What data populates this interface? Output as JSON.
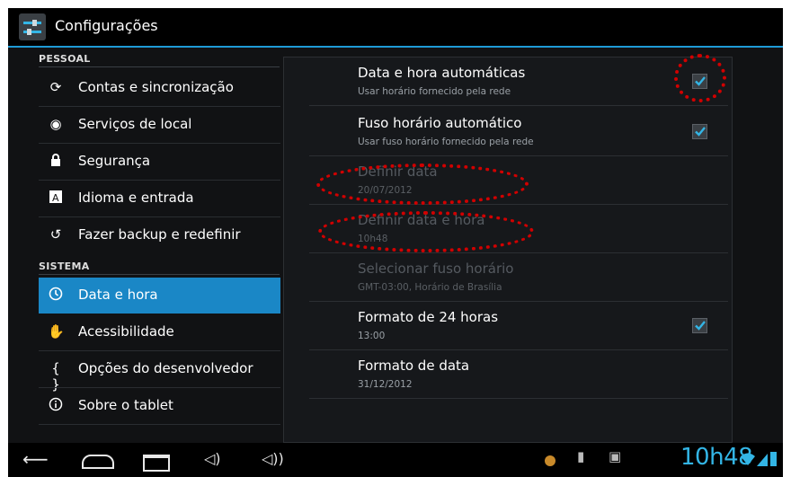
{
  "app": {
    "title": "Configurações"
  },
  "sidebar": {
    "sections": [
      {
        "label": "PESSOAL"
      },
      {
        "label": "SISTEMA"
      }
    ],
    "items": [
      {
        "label": "Contas e sincronização",
        "icon": "sync-icon"
      },
      {
        "label": "Serviços de local",
        "icon": "location-icon"
      },
      {
        "label": "Segurança",
        "icon": "lock-icon"
      },
      {
        "label": "Idioma e entrada",
        "icon": "language-icon"
      },
      {
        "label": "Fazer backup e redefinir",
        "icon": "backup-icon"
      },
      {
        "label": "Data e hora",
        "icon": "clock-icon",
        "active": true
      },
      {
        "label": "Acessibilidade",
        "icon": "hand-icon"
      },
      {
        "label": "Opções do desenvolvedor",
        "icon": "braces-icon"
      },
      {
        "label": "Sobre o tablet",
        "icon": "info-icon"
      }
    ]
  },
  "prefs": [
    {
      "title": "Data e hora automáticas",
      "summary": "Usar horário fornecido pela rede",
      "checked": true,
      "enabled": true
    },
    {
      "title": "Fuso horário automático",
      "summary": "Usar fuso horário fornecido pela rede",
      "checked": true,
      "enabled": true
    },
    {
      "title": "Definir data",
      "summary": "20/07/2012",
      "enabled": false
    },
    {
      "title": "Definir data e hora",
      "summary": "10h48",
      "enabled": false
    },
    {
      "title": "Selecionar fuso horário",
      "summary": "GMT-03:00, Horário de Brasília",
      "enabled": false
    },
    {
      "title": "Formato de 24 horas",
      "summary": "13:00",
      "checked": true,
      "enabled": true
    },
    {
      "title": "Formato de data",
      "summary": "31/12/2012",
      "enabled": true
    }
  ],
  "statusbar": {
    "time": "10h48"
  },
  "colors": {
    "accent": "#33b5e5",
    "selected": "#1a87c6",
    "annotation": "#d10000"
  }
}
